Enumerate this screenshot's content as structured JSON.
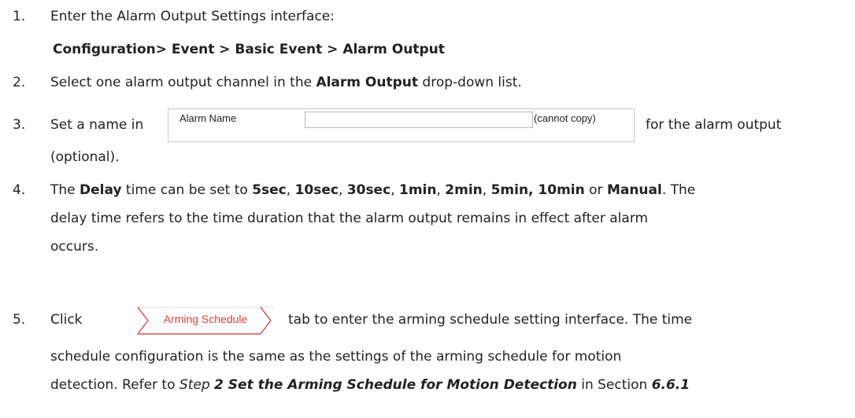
{
  "steps": [
    {
      "number": "1.",
      "text": "Enter the Alarm Output Settings interface:",
      "path": "Configuration> Event > Basic Event > Alarm Output"
    },
    {
      "number": "2.",
      "pre": "Select one alarm output channel in the ",
      "bold": "Alarm Output",
      "post": " drop-down list."
    },
    {
      "number": "3.",
      "pre": "Set a name in",
      "post": "for the alarm output",
      "cont": "(optional).",
      "widget": {
        "label": "Alarm Name",
        "input_value": "",
        "hint": "(cannot copy)"
      }
    },
    {
      "number": "4.",
      "t1": "The ",
      "delay": "Delay",
      "t2": " time can be set to ",
      "v1": "5sec",
      "c1": ", ",
      "v2": "10sec",
      "c2": ", ",
      "v3": "30sec",
      "c3": ", ",
      "v4": "1min",
      "c4": ", ",
      "v5": "2min",
      "c5": ", ",
      "v6": "5min, 10min",
      "c6": " or ",
      "v7": "Manual",
      "t3": ". The",
      "line2": "delay time refers to the time duration that the alarm output remains in effect after alarm",
      "line3": "occurs."
    },
    {
      "number": "5.",
      "pre": "Click",
      "tab_label": "Arming Schedule",
      "post": "tab to enter the arming schedule setting interface. The time",
      "line2": "schedule configuration is the same as the settings of the arming schedule for motion",
      "l3a": "detection. Refer to ",
      "l3b": "Step ",
      "l3c": "2 Set the Arming Schedule for Motion Detection",
      "l3d": " in Section ",
      "l3e": "6.6.1"
    }
  ]
}
